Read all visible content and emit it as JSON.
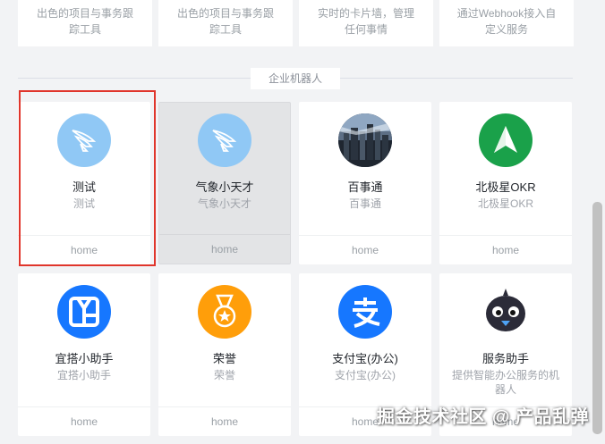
{
  "top_cards": [
    {
      "desc": "出色的项目与事务跟\n踪工具"
    },
    {
      "desc": "出色的项目与事务跟\n踪工具"
    },
    {
      "desc": "实时的卡片墙，管理\n任何事情"
    },
    {
      "desc": "通过Webhook接入自\n定义服务"
    }
  ],
  "section": {
    "label": "企业机器人"
  },
  "cards": [
    {
      "name": "测试",
      "desc": "测试",
      "footer": "home",
      "icon": "wing-icon",
      "color": "#90c8f5"
    },
    {
      "name": "气象小天才",
      "desc": "气象小天才",
      "footer": "home",
      "icon": "wing-icon",
      "color": "#90c8f5"
    },
    {
      "name": "百事通",
      "desc": "百事通",
      "footer": "home",
      "icon": "city-photo-icon",
      "color": "#2c3440"
    },
    {
      "name": "北极星OKR",
      "desc": "北极星OKR",
      "footer": "home",
      "icon": "north-star-arrow-icon",
      "color": "#1aa14a"
    },
    {
      "name": "宜搭小助手",
      "desc": "宜搭小助手",
      "footer": "home",
      "icon": "yida-y-icon",
      "color": "#1677ff"
    },
    {
      "name": "荣誉",
      "desc": "荣誉",
      "footer": "home",
      "icon": "medal-icon",
      "color": "#ff9e0a"
    },
    {
      "name": "支付宝(办公)",
      "desc": "支付宝(办公)",
      "footer": "home",
      "icon": "alipay-icon",
      "color": "#1677ff"
    },
    {
      "name": "服务助手",
      "desc": "提供智能办公服务的机器人",
      "footer": "home",
      "icon": "robot-bird-icon",
      "color": "#2b2b38"
    }
  ],
  "watermark": "掘金技术社区 @ 产品乱弹"
}
